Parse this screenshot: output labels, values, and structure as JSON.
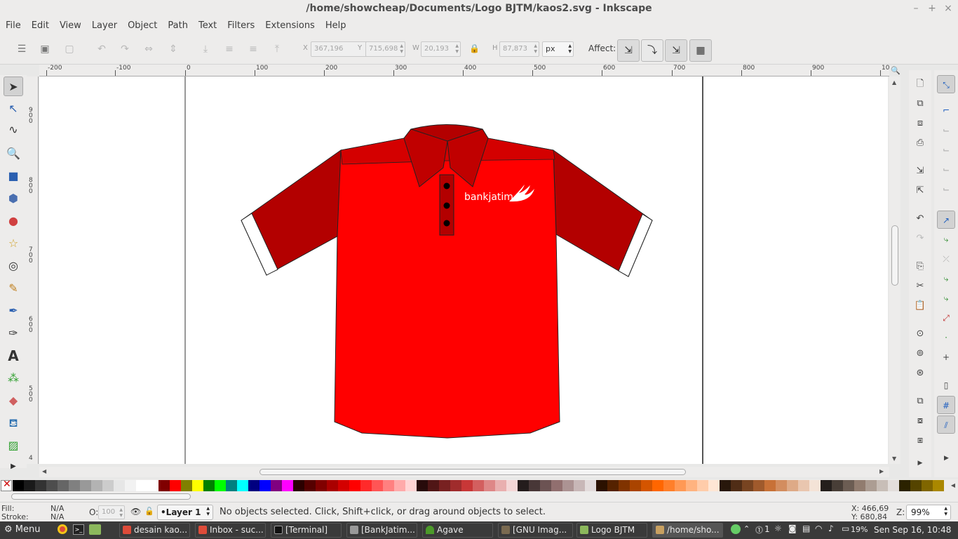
{
  "window": {
    "title": "/home/showcheap/Documents/Logo BJTM/kaos2.svg - Inkscape",
    "minimize": "–",
    "maximize": "+",
    "close": "×"
  },
  "menu": [
    "File",
    "Edit",
    "View",
    "Layer",
    "Object",
    "Path",
    "Text",
    "Filters",
    "Extensions",
    "Help"
  ],
  "toolbar": {
    "x_label": "X",
    "x_value": "367,196",
    "y_label": "Y",
    "y_value": "715,698",
    "w_label": "W",
    "w_value": "20,193",
    "h_label": "H",
    "h_value": "87,873",
    "unit": "px",
    "affect_label": "Affect:"
  },
  "ruler": {
    "h_labels": [
      "-200",
      "-100",
      "0",
      "100",
      "200",
      "300",
      "400",
      "500",
      "600",
      "700",
      "800",
      "900",
      "10"
    ],
    "v_labels": [
      "9\n0\n0",
      "8\n0\n0",
      "7\n0\n0",
      "6\n0\n0",
      "5\n0\n0",
      "4"
    ]
  },
  "drawing": {
    "logo_text": "bankjatim",
    "shirt_color": "#ff0000",
    "shirt_dark": "#b30000",
    "shirt_mid": "#d40000"
  },
  "palette": [
    "#000000",
    "#1a1a1a",
    "#333333",
    "#4d4d4d",
    "#666666",
    "#808080",
    "#999999",
    "#b3b3b3",
    "#cccccc",
    "#e6e6e6",
    "#f2f2f2",
    "#ffffff",
    "#ffffff",
    "#800000",
    "#ff0000",
    "#808000",
    "#ffff00",
    "#008000",
    "#00ff00",
    "#008080",
    "#00ffff",
    "#000080",
    "#0000ff",
    "#800080",
    "#ff00ff",
    "#2b0000",
    "#550000",
    "#800000",
    "#aa0000",
    "#d40000",
    "#ff0000",
    "#ff2a2a",
    "#ff5555",
    "#ff8080",
    "#ffaaaa",
    "#ffd5d5",
    "#280b0b",
    "#501616",
    "#782121",
    "#a02c2c",
    "#c83737",
    "#d35f5f",
    "#de8787",
    "#e9afaf",
    "#f4d7d7",
    "#241c1c",
    "#483737",
    "#6c5353",
    "#916f6f",
    "#ac9393",
    "#c8b7b7",
    "#e3dbdb",
    "#2b1100",
    "#552200",
    "#803300",
    "#aa4400",
    "#d45500",
    "#ff6600",
    "#ff7f2a",
    "#ff9955",
    "#ffb380",
    "#ffccaa",
    "#ffe6d5",
    "#28170b",
    "#502d16",
    "#784421",
    "#a05a2c",
    "#c87137",
    "#d38d5f",
    "#deaa87",
    "#e9c6af",
    "#f4e3d7",
    "#241f1c",
    "#483e37",
    "#6c5d53",
    "#917c6f",
    "#ac9d93",
    "#c8beb7",
    "#e3dedb",
    "#2b2200",
    "#554400",
    "#806600",
    "#aa8800"
  ],
  "status": {
    "fill_label": "Fill:",
    "fill_value": "N/A",
    "stroke_label": "Stroke:",
    "stroke_value": "N/A",
    "opacity_label": "O:",
    "opacity_value": "100",
    "layer": "•Layer 1",
    "message": "No objects selected. Click, Shift+click, or drag around objects to select.",
    "x_coord": "X: 466,69",
    "y_coord": "Y: 680,84",
    "zoom_label": "Z:",
    "zoom_value": "99%"
  },
  "taskbar": {
    "menu": "Menu",
    "tasks": [
      "desain kao...",
      "Inbox - suc...",
      "[Terminal]",
      "[BankJatim...",
      "Agave",
      "[GNU Imag...",
      "Logo BJTM",
      "/home/sho..."
    ],
    "battery": "19%",
    "clock": "Sen Sep 16, 10:48",
    "tray_count": "1"
  }
}
